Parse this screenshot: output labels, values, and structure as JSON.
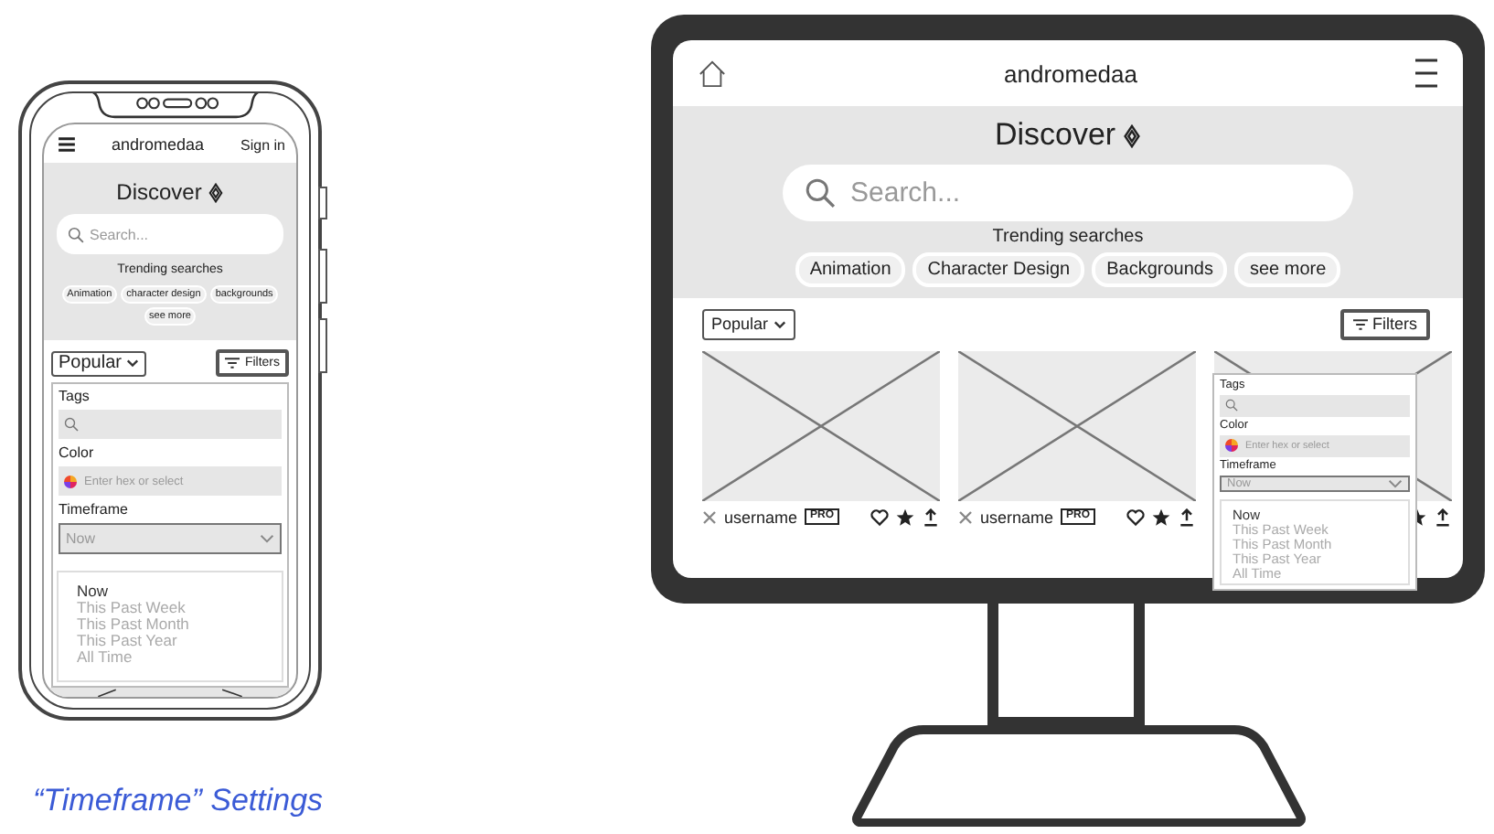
{
  "phone": {
    "app_name": "andromedaa",
    "sign_in": "Sign in",
    "title": "Discover",
    "search_placeholder": "Search...",
    "trending_label": "Trending searches",
    "tags": [
      "Animation",
      "character design",
      "backgrounds",
      "see more"
    ],
    "sort": "Popular",
    "filters_button": "Filters",
    "filter_panel": {
      "tags_label": "Tags",
      "color_label": "Color",
      "color_placeholder": "Enter hex or select",
      "timeframe_label": "Timeframe",
      "timeframe_value": "Now",
      "options": [
        {
          "label": "Now",
          "selected": true
        },
        {
          "label": "This Past Week",
          "selected": false
        },
        {
          "label": "This Past Month",
          "selected": false
        },
        {
          "label": "This Past Year",
          "selected": false
        },
        {
          "label": "All Time",
          "selected": false
        }
      ]
    }
  },
  "caption": "“Timeframe” Settings",
  "monitor": {
    "app_name": "andromedaa",
    "title": "Discover",
    "search_placeholder": "Search...",
    "trending_label": "Trending searches",
    "tags": [
      "Animation",
      "Character Design",
      "Backgrounds",
      "see more"
    ],
    "sort": "Popular",
    "filters_button": "Filters",
    "cards": [
      {
        "kind": "full",
        "username": "username",
        "badge": "PRO"
      },
      {
        "kind": "full",
        "username": "username",
        "badge": "PRO"
      },
      {
        "kind": "covered"
      }
    ],
    "filter_panel": {
      "tags_label": "Tags",
      "color_label": "Color",
      "color_placeholder": "Enter hex or select",
      "timeframe_label": "Timeframe",
      "timeframe_value": "Now",
      "options": [
        {
          "label": "Now",
          "selected": true
        },
        {
          "label": "This Past Week",
          "selected": false
        },
        {
          "label": "This Past Month",
          "selected": false
        },
        {
          "label": "This Past Year",
          "selected": false
        },
        {
          "label": "All Time",
          "selected": false
        }
      ]
    }
  }
}
